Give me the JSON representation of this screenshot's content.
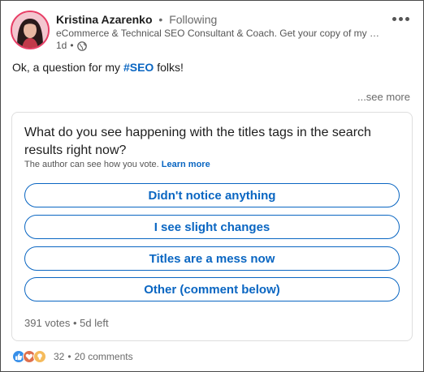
{
  "post": {
    "author_name": "Kristina Azarenko",
    "separator": "•",
    "follow_status": "Following",
    "headline": "eCommerce & Technical SEO Consultant & Coach. Get your copy of my eCo...",
    "time_ago": "1d",
    "time_sep": "•",
    "text_before": "Ok, a question for my ",
    "hashtag": "#SEO",
    "text_after": " folks!",
    "see_more": "...see more"
  },
  "poll": {
    "question": "What do you see happening with the titles tags in the search results right now?",
    "note": "The author can see how you vote.",
    "learn_more": "Learn more",
    "options": [
      {
        "label": "Didn't notice anything"
      },
      {
        "label": "I see slight changes"
      },
      {
        "label": "Titles are a mess now"
      },
      {
        "label": "Other (comment below)"
      }
    ],
    "footer": "391 votes • 5d left"
  },
  "social": {
    "reactions_count": "32",
    "separator": "•",
    "comments": "20 comments"
  },
  "colors": {
    "accent": "#0a66c2",
    "like": "#378fe9",
    "love": "#df704d",
    "insightful": "#f5bb5c"
  }
}
